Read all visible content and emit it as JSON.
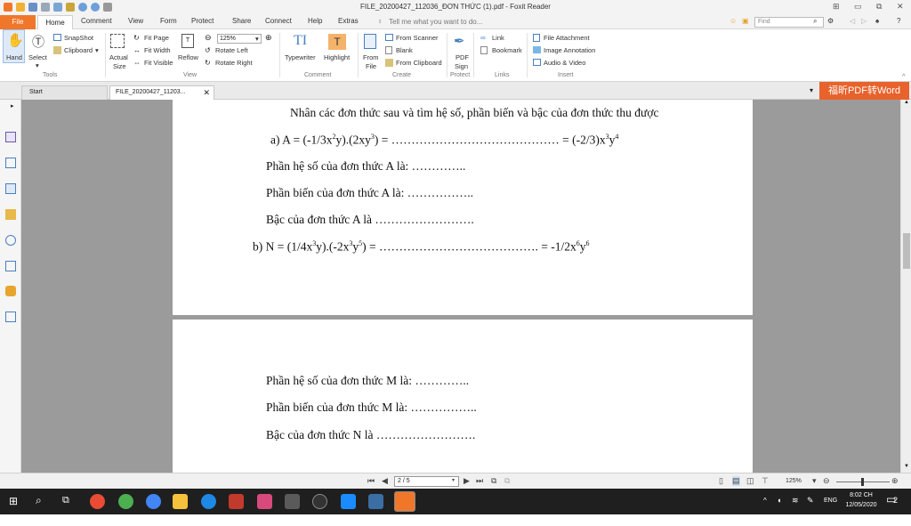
{
  "window": {
    "title": "FILE_20200427_112036_ĐƠN THỨC (1).pdf - Foxit Reader"
  },
  "ribbon_tabs": [
    "File",
    "Home",
    "Comment",
    "View",
    "Form",
    "Protect",
    "Share",
    "Connect",
    "Help",
    "Extras"
  ],
  "tell_me": "Tell me what you want to do...",
  "find": {
    "placeholder": "Find"
  },
  "ribbon": {
    "hand": "Hand",
    "select": "Select",
    "snapshot": "SnapShot",
    "clipboard": "Clipboard",
    "tools_group": "Tools",
    "actual_size_1": "Actual",
    "actual_size_2": "Size",
    "fit_page": "Fit Page",
    "fit_width": "Fit Width",
    "fit_visible": "Fit Visible",
    "reflow": "Reflow",
    "zoom_value": "125%",
    "rotate_left": "Rotate Left",
    "rotate_right": "Rotate Right",
    "view_group": "View",
    "typewriter": "Typewriter",
    "highlight": "Highlight",
    "comment_group": "Comment",
    "from_file_1": "From",
    "from_file_2": "File",
    "from_scanner": "From Scanner",
    "blank": "Blank",
    "from_clipboard": "From Clipboard",
    "create_group": "Create",
    "pdf_sign_1": "PDF",
    "pdf_sign_2": "Sign",
    "protect_group": "Protect",
    "link": "Link",
    "bookmark": "Bookmark",
    "links_group": "Links",
    "file_attachment": "File Attachment",
    "image_annotation": "Image Annotation",
    "audio_video": "Audio & Video",
    "insert_group": "Insert"
  },
  "doc_tabs": {
    "start": "Start",
    "file": "FILE_20200427_11203..."
  },
  "promo": "福昕PDF转Word",
  "document": {
    "p1_heading": "Nhân các đơn thức sau và tìm hệ số, phần biến và bậc của đơn thức thu được",
    "p1_a_pre": "a)  A =  (-1/3x",
    "p1_a_e1": "2",
    "p1_a_mid1": "y).(2xy",
    "p1_a_e2": "3",
    "p1_a_mid2": ") = …………………………………… = (-2/3)x",
    "p1_a_e3": "3",
    "p1_a_mid3": "y",
    "p1_a_e4": "4",
    "p1_line2": "Phần hệ số của đơn thức A là:   …………..",
    "p1_line3": "Phần biến của đơn thức A là: ……………..",
    "p1_line4": "Bậc của đơn thức A là …………………….",
    "p1_b_pre": "b) N =  (1/4x",
    "p1_b_e1": "3",
    "p1_b_mid1": "y).(-2x",
    "p1_b_e2": "3",
    "p1_b_mid2": "y",
    "p1_b_e3": "5",
    "p1_b_mid3": ") = …………………………………. =  -1/2x",
    "p1_b_e4": "6",
    "p1_b_mid4": "y",
    "p1_b_e5": "6",
    "p2_line1": "Phần hệ số của đơn thức M là:   …………..",
    "p2_line2": "Phần biến của đơn thức M là: ……………..",
    "p2_line3": "Bậc của đơn thức N là ……………………."
  },
  "status": {
    "page": "2 / 5",
    "zoom": "125%"
  },
  "taskbar": {
    "lang": "ENG",
    "time": "8:02 CH",
    "date": "12/05/2020",
    "notifications": "2"
  }
}
